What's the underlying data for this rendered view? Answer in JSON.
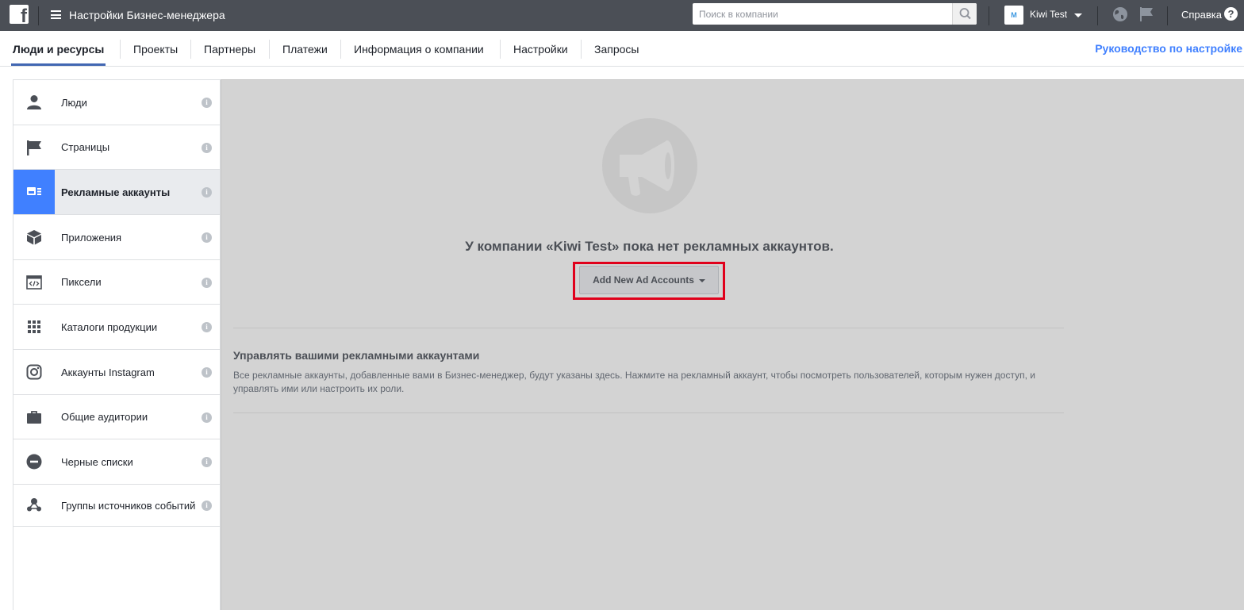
{
  "topbar": {
    "app_title": "Настройки Бизнес-менеджера",
    "search_placeholder": "Поиск в компании",
    "account_avatar_letter": "M",
    "account_name": "Kiwi Test",
    "help_label": "Справка",
    "help_glyph": "?",
    "colors": {
      "bar": "#4b4f56",
      "accent": "#4080ff"
    }
  },
  "tabs": {
    "items": [
      {
        "label": "Люди и ресурсы",
        "active": true
      },
      {
        "label": "Проекты"
      },
      {
        "label": "Партнеры"
      },
      {
        "label": "Платежи"
      },
      {
        "label": "Информация о компании"
      },
      {
        "label": "Настройки"
      },
      {
        "label": "Запросы"
      }
    ],
    "guide_link": "Руководство по настройке"
  },
  "sidebar": {
    "info_glyph": "i",
    "items": [
      {
        "label": "Люди",
        "icon": "person-icon"
      },
      {
        "label": "Страницы",
        "icon": "flag-icon"
      },
      {
        "label": "Рекламные аккаунты",
        "icon": "ad-account-icon",
        "active": true
      },
      {
        "label": "Приложения",
        "icon": "cube-icon"
      },
      {
        "label": "Пиксели",
        "icon": "code-window-icon"
      },
      {
        "label": "Каталоги продукции",
        "icon": "grid-icon"
      },
      {
        "label": "Аккаунты Instagram",
        "icon": "instagram-icon"
      },
      {
        "label": "Общие аудитории",
        "icon": "briefcase-icon"
      },
      {
        "label": "Черные списки",
        "icon": "block-icon"
      },
      {
        "label": "Группы источников событий",
        "icon": "event-group-icon"
      }
    ]
  },
  "main": {
    "empty_title": "У компании «Kiwi Test» пока нет рекламных аккаунтов.",
    "add_button_label": "Add New Ad Accounts",
    "manage_title": "Управлять вашими рекламными аккаунтами",
    "manage_description": "Все рекламные аккаунты, добавленные вами в Бизнес-менеджер, будут указаны здесь. Нажмите на рекламный аккаунт, чтобы посмотреть пользователей, которым нужен доступ, и управлять ими или настроить их роли."
  }
}
